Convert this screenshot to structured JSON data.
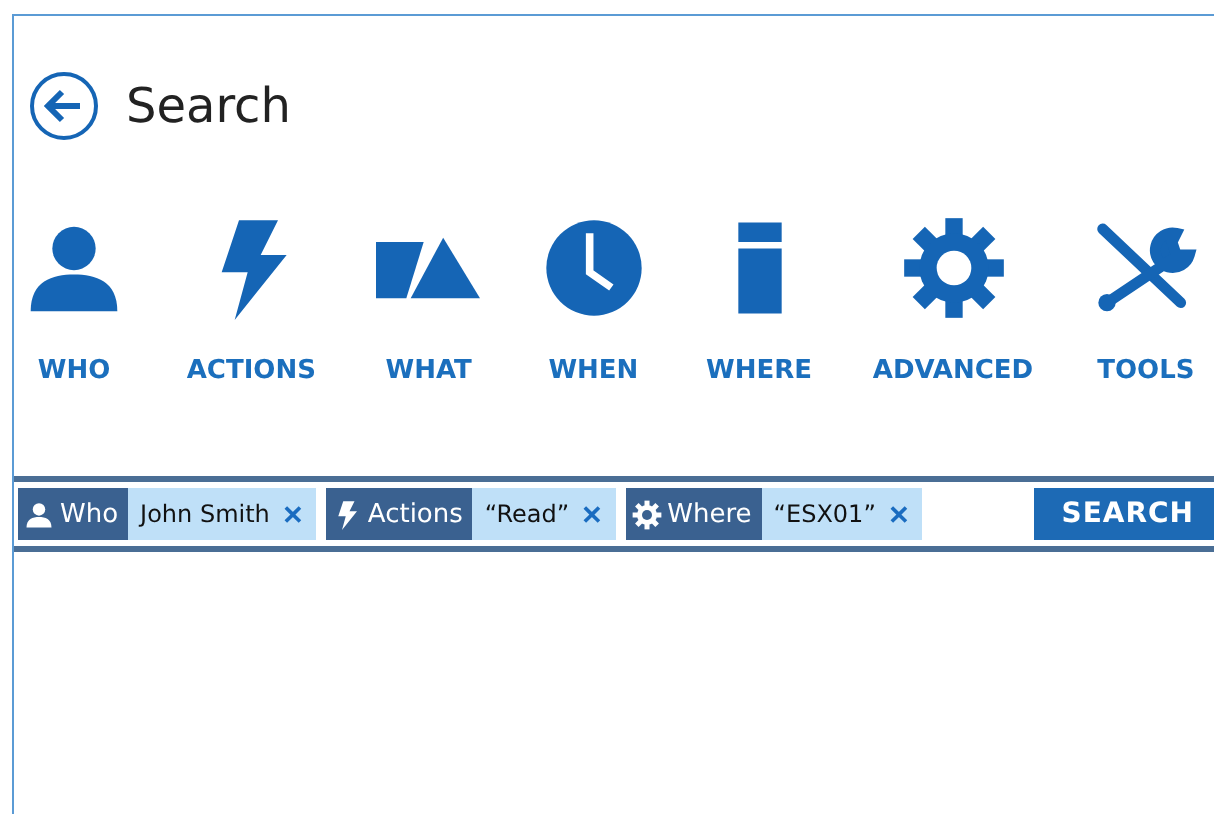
{
  "header": {
    "title": "Search"
  },
  "categories": [
    {
      "kind": "person",
      "label": "WHO"
    },
    {
      "kind": "bolt",
      "label": "ACTIONS"
    },
    {
      "kind": "shapes",
      "label": "WHAT"
    },
    {
      "kind": "clock",
      "label": "WHEN"
    },
    {
      "kind": "pillar",
      "label": "WHERE"
    },
    {
      "kind": "gear",
      "label": "ADVANCED"
    },
    {
      "kind": "tools",
      "label": "TOOLS"
    }
  ],
  "filters": [
    {
      "kind": "person",
      "label": "Who",
      "value": "John Smith",
      "remove": "✕"
    },
    {
      "kind": "bolt",
      "label": "Actions",
      "value": "“Read”",
      "remove": "✕"
    },
    {
      "kind": "gear",
      "label": "Where",
      "value": "“ESX01”",
      "remove": "✕"
    }
  ],
  "search_button": "SEARCH"
}
